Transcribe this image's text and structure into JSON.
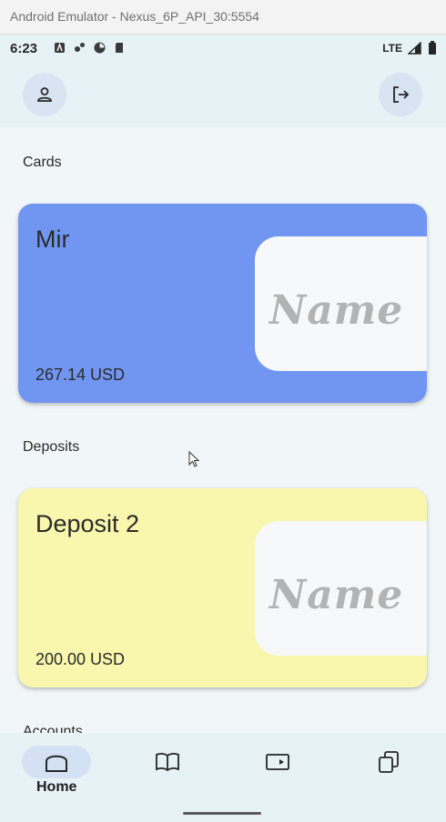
{
  "window": {
    "title": "Android Emulator - Nexus_6P_API_30:5554"
  },
  "status_bar": {
    "time": "6:23",
    "network": "LTE"
  },
  "top_bar": {
    "profile_icon": "person-icon",
    "logout_icon": "logout-icon"
  },
  "sections": {
    "cards": {
      "label": "Cards",
      "items": [
        {
          "title": "Mir",
          "amount": "267.14 USD",
          "brand_text": "Name",
          "color": "#7196f1"
        }
      ]
    },
    "deposits": {
      "label": "Deposits",
      "items": [
        {
          "title": "Deposit 2",
          "amount": "200.00 USD",
          "brand_text": "Name",
          "color": "#f8f7ad"
        }
      ]
    },
    "accounts": {
      "label": "Accounts"
    }
  },
  "bottom_nav": {
    "items": [
      {
        "icon": "home-icon",
        "label": "Home",
        "active": true
      },
      {
        "icon": "book-icon"
      },
      {
        "icon": "video-icon"
      },
      {
        "icon": "copy-icon"
      }
    ]
  },
  "colors": {
    "accent": "#d4e1f4",
    "background": "#f1f6f8"
  }
}
